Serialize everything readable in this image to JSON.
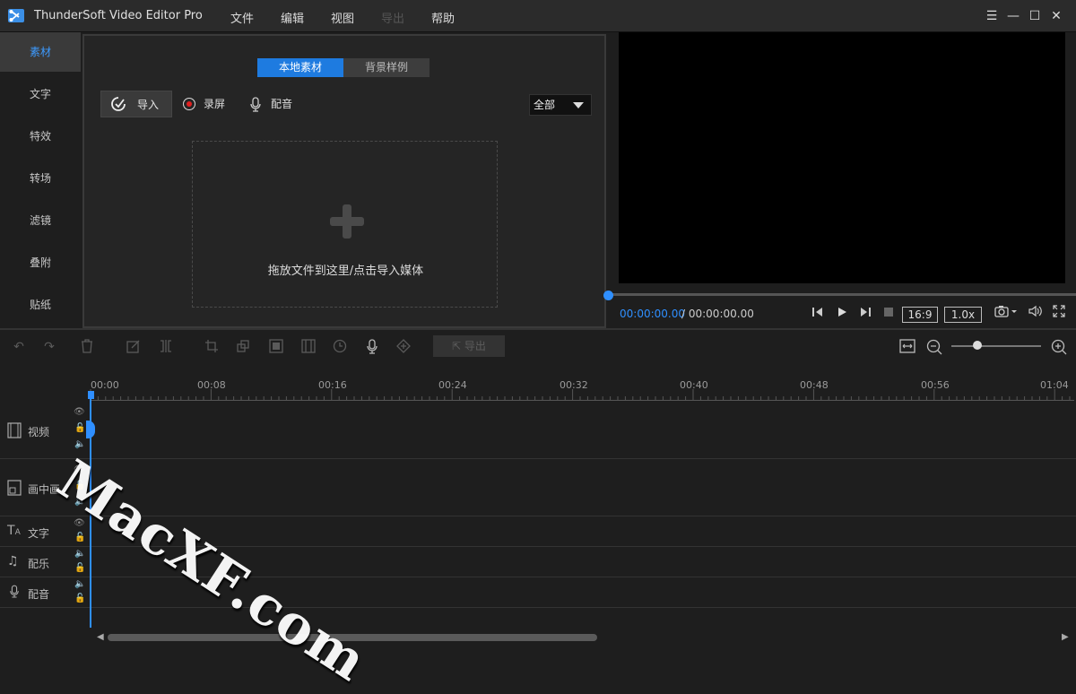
{
  "titlebar": {
    "title": "ThunderSoft Video Editor Pro",
    "menus": [
      "文件",
      "编辑",
      "视图",
      "导出",
      "帮助"
    ],
    "disabled_menu": "导出"
  },
  "sidebar": {
    "items": [
      {
        "label": "素材",
        "active": true
      },
      {
        "label": "文字"
      },
      {
        "label": "特效"
      },
      {
        "label": "转场"
      },
      {
        "label": "滤镜"
      },
      {
        "label": "叠附"
      },
      {
        "label": "贴纸"
      }
    ]
  },
  "media": {
    "tabs": [
      "本地素材",
      "背景样例"
    ],
    "import_label": "导入",
    "record_label": "录屏",
    "voice_label": "配音",
    "filter_value": "全部",
    "drop_text": "拖放文件到这里/点击导入媒体"
  },
  "preview": {
    "current_time": "00:00:00.00",
    "total_time": "/ 00:00:00.00",
    "ratio": "16:9",
    "speed": "1.0x"
  },
  "timeline": {
    "export_label": "导出",
    "ticks": [
      "00:00",
      "00:08",
      "00:16",
      "00:24",
      "00:32",
      "00:40",
      "00:48",
      "00:56",
      "01:04"
    ],
    "tracks": [
      "视频",
      "画中画",
      "文字",
      "配乐",
      "配音"
    ]
  },
  "watermark": "MacXF.com",
  "colors": {
    "accent": "#2f8fff",
    "tab_active": "#1e7be0",
    "record": "#e02020"
  }
}
